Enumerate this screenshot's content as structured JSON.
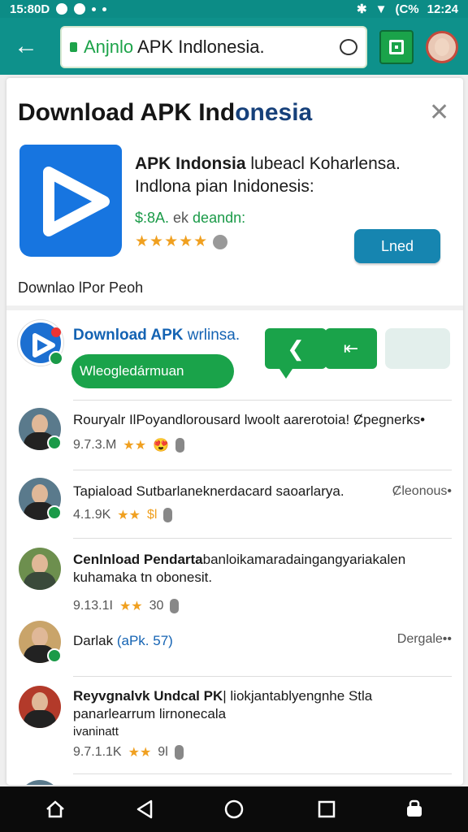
{
  "status": {
    "time_left": "15:80D",
    "battery": "(C%",
    "time_right": "12:24"
  },
  "appbar": {
    "url_green": "Anjnlo",
    "url_rest": " APK Indlonesia."
  },
  "dialog": {
    "title_black": "Download APK Ind",
    "title_blue": "onesia",
    "app_name_bold": "APK Indonsia",
    "app_name_rest": " lubeacl Koharlensa. Indlona pian Inidonesis:",
    "price_green": "$:8A.",
    "price_gray": " ek",
    "price_tail": " deandn:",
    "stars": "★★★★★",
    "load_button": "Lned",
    "sub_note": "Downlao lPor Peoh"
  },
  "featured": {
    "title_bold": "Download APK",
    "title_rest": " wrlinsa.",
    "button_label": "Wleogledármuan"
  },
  "list": [
    {
      "name": "Rouryalr IlPoyandlorousard lwoolt aarerotoia! Ȼpegnerks•",
      "meta": "9.7.3.M",
      "stars": "★★",
      "extra": "😍"
    },
    {
      "name": "Tapiaload Sutbarlaneknerdacard saoarlarya.",
      "right": "Ȼleonous•",
      "meta": "4.1.9K",
      "stars": "★★",
      "extra": "$l"
    },
    {
      "name_bold": "Cenlnload Pendarta",
      "name_rest": "banloikamaradaingangyariakalen kuhamaka tn obonesit.",
      "meta": "9.13.1I",
      "stars": "★★",
      "extra": "30"
    },
    {
      "name": "Darlak",
      "name_blue": " (aPk. 57)",
      "right": "Dergale••"
    },
    {
      "name_bold": "Reyvgnalvk Undcal PK",
      "name_rest": "| liokjantablyengnhe Stla panarlearrum lirnonecala",
      "name_line3": "ivaninatt",
      "meta": "9.7.1.1K",
      "stars": "★★",
      "extra": "9l"
    }
  ]
}
